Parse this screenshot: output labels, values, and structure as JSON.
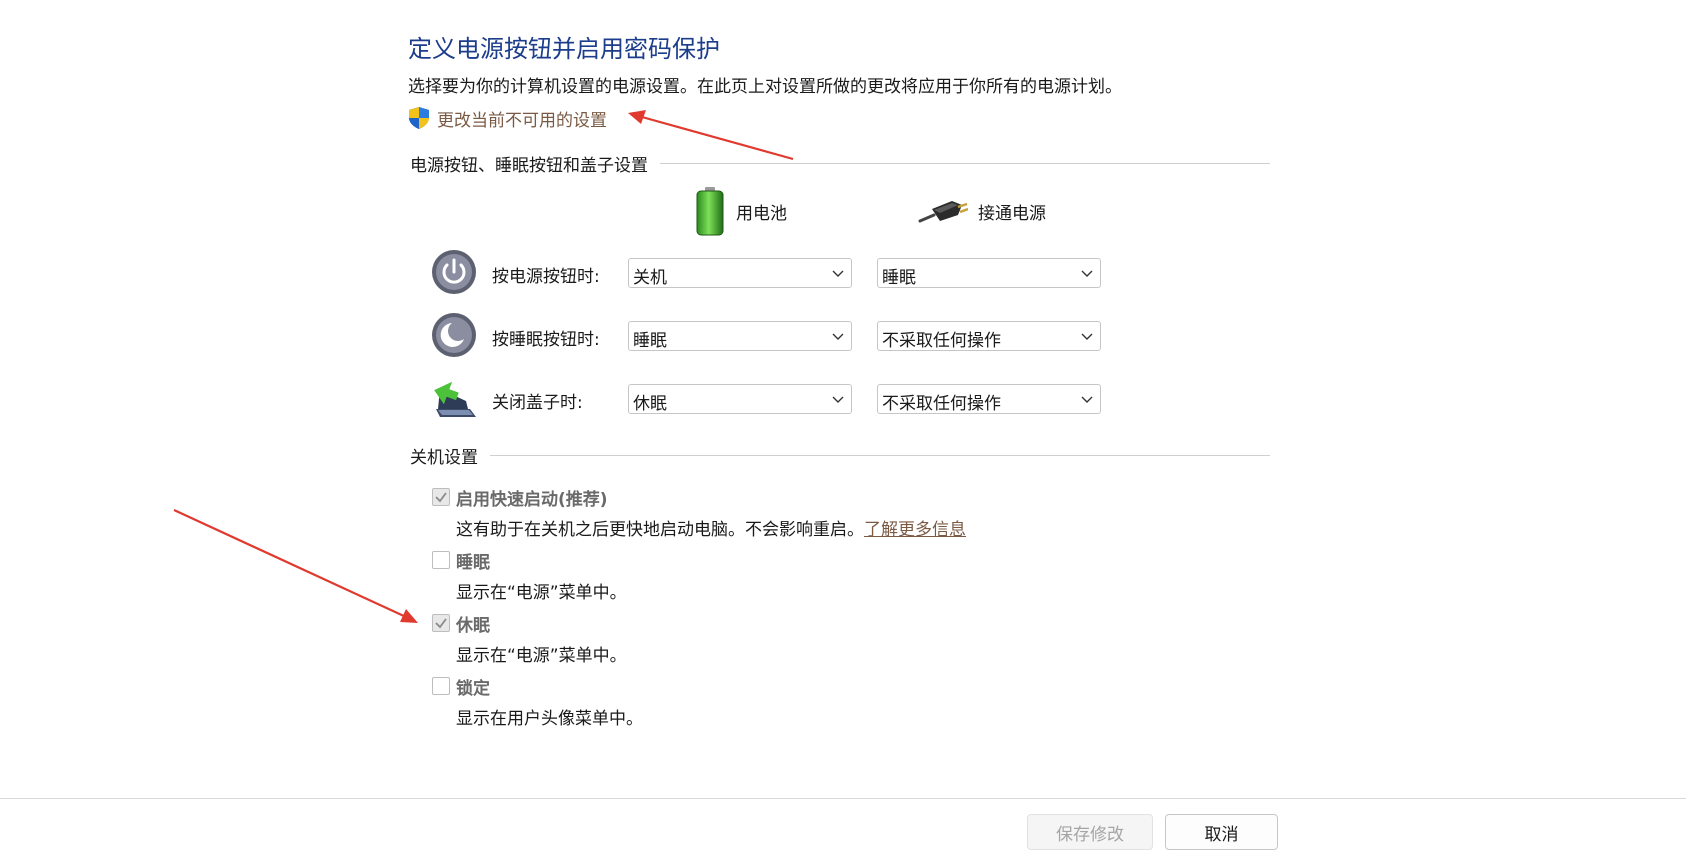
{
  "page": {
    "title": "定义电源按钮并启用密码保护",
    "description": "选择要为你的计算机设置的电源设置。在此页上对设置所做的更改将应用于你所有的电源计划。",
    "change_link": "更改当前不可用的设置"
  },
  "power_section": {
    "heading": "电源按钮、睡眠按钮和盖子设置",
    "battery_label": "用电池",
    "plugged_label": "接通电源",
    "rows": [
      {
        "label": "按电源按钮时:",
        "battery": "关机",
        "plugged": "睡眠"
      },
      {
        "label": "按睡眠按钮时:",
        "battery": "睡眠",
        "plugged": "不采取任何操作"
      },
      {
        "label": "关闭盖子时:",
        "battery": "休眠",
        "plugged": "不采取任何操作"
      }
    ]
  },
  "shutdown_section": {
    "heading": "关机设置",
    "options": [
      {
        "label": "启用快速启动(推荐)",
        "desc": "这有助于在关机之后更快地启动电脑。不会影响重启。",
        "link": "了解更多信息",
        "checked": true
      },
      {
        "label": "睡眠",
        "desc": "显示在“电源”菜单中。",
        "checked": false
      },
      {
        "label": "休眠",
        "desc": "显示在“电源”菜单中。",
        "checked": true
      },
      {
        "label": "锁定",
        "desc": "显示在用户头像菜单中。",
        "checked": false
      }
    ]
  },
  "footer": {
    "save_label": "保存修改",
    "cancel_label": "取消"
  },
  "icons": {
    "shield": "uac-shield-icon",
    "battery": "battery-icon",
    "plug": "power-plug-icon",
    "power": "power-button-icon",
    "sleep": "sleep-button-icon",
    "lid": "laptop-lid-icon",
    "chevron": "chevron-down-icon",
    "check": "checkmark-icon"
  },
  "colors": {
    "title": "#1c3d8c",
    "link": "#7b5a44",
    "annotation_arrow": "#e03a2f"
  }
}
